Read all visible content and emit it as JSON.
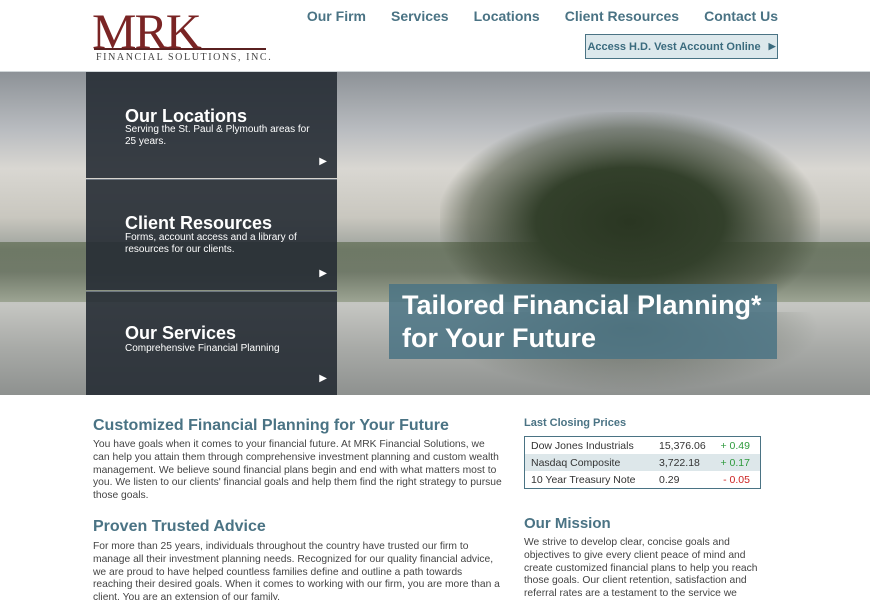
{
  "logo": {
    "mark": "MRK",
    "sub": "FINANCIAL SOLUTIONS, INC."
  },
  "nav": [
    "Our Firm",
    "Services",
    "Locations",
    "Client Resources",
    "Contact Us"
  ],
  "access_button": {
    "label": "Access H.D. Vest Account Online",
    "arrow": "▶"
  },
  "hero": {
    "panels": [
      {
        "title": "Our Locations",
        "text": "Serving the St. Paul & Plymouth areas for 25 years.",
        "arrow": "▶"
      },
      {
        "title": "Client Resources",
        "text": "Forms, account access and a library of resources for our clients.",
        "arrow": "▶"
      },
      {
        "title": "Our Services",
        "text": "Comprehensive Financial Planning",
        "arrow": "▶"
      }
    ],
    "tagline": {
      "line1": "Tailored Financial Planning*",
      "line2": "for Your Future"
    }
  },
  "main": {
    "section1": {
      "title": "Customized Financial Planning for Your Future",
      "body": "You have goals when it comes to your financial future. At MRK Financial Solutions, we can help you attain them through comprehensive investment planning and custom wealth management. We believe sound financial plans begin and end with what matters most to you. We listen to our clients' financial goals and help them find the right strategy to pursue those goals."
    },
    "section2": {
      "title": "Proven Trusted Advice",
      "body": "For more than 25 years, individuals throughout the country have trusted our firm to manage all their investment planning needs. Recognized for our quality financial advice, we are proud to have helped countless families define and outline a path towards reaching their desired goals. When it comes to working with our firm, you are more than a client. You are an extension of our family."
    }
  },
  "sidebar": {
    "prices_title": "Last Closing Prices",
    "prices": [
      {
        "name": "Dow Jones Industrials",
        "value": "15,376.06",
        "change": "+ 0.49"
      },
      {
        "name": "Nasdaq Composite",
        "value": "3,722.18",
        "change": "+ 0.17"
      },
      {
        "name": "10 Year Treasury Note",
        "value": "0.29",
        "change": "- 0.05"
      }
    ],
    "mission_title": "Our Mission",
    "mission_text": "We strive to develop clear, concise goals and objectives to give every client peace of mind and create customized financial plans to help you reach those goals. Our client retention, satisfaction and referral rates are a testament to the service we"
  },
  "colors": {
    "accent": "#4a7384",
    "brand": "#7a2424",
    "up": "#2e9a3c",
    "down": "#cc2222"
  }
}
